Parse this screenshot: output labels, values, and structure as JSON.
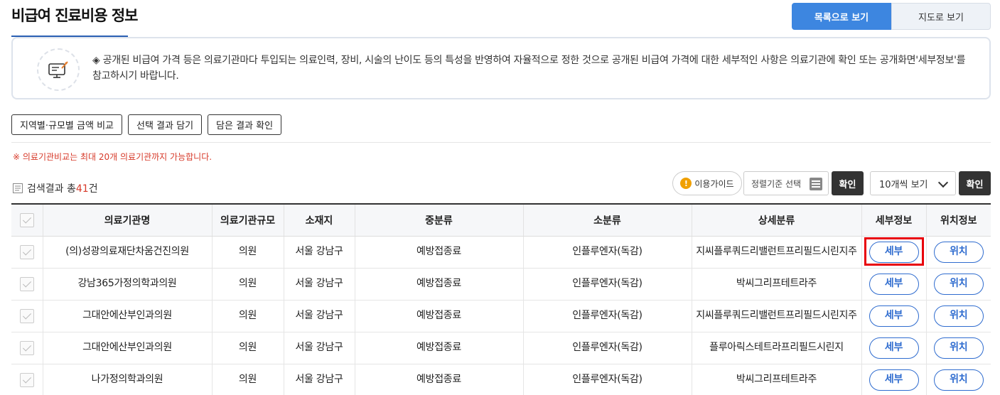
{
  "header": {
    "title": "비급여 진료비용 정보",
    "list_view_label": "목록으로 보기",
    "map_view_label": "지도로 보기"
  },
  "notice": {
    "text": "◈ 공개된 비급여 가격 등은 의료기관마다 투입되는 의료인력, 장비, 시술의 난이도 등의 특성을 반영하여 자율적으로 정한 것으로 공개된 비급여 가격에 대한 세부적인 사항은 의료기관에 확인 또는 공개화면'세부정보'를 참고하시기 바랍니다.",
    "icon": "monitor-icon"
  },
  "actions": {
    "compare_label": "지역별·규모별 금액 비교",
    "select_add_label": "선택 결과 담기",
    "check_saved_label": "담은 결과 확인"
  },
  "compare_note": "※ 의료기관비교는 최대 20개 의료기관까지 가능합니다.",
  "results": {
    "prefix": "검색결과 총",
    "count": "41",
    "suffix": "건"
  },
  "toolbar": {
    "guide_label": "이용가이드",
    "sort_label": "정렬기준 선택",
    "confirm_label": "확인",
    "page_size_label": "10개씩 보기",
    "confirm2_label": "확인"
  },
  "table": {
    "headers": [
      "의료기관명",
      "의료기관규모",
      "소재지",
      "중분류",
      "소분류",
      "상세분류",
      "세부정보",
      "위치정보"
    ],
    "detail_label": "세부",
    "location_label": "위치",
    "rows": [
      {
        "name": "(의)성광의료재단차움건진의원",
        "scale": "의원",
        "location": "서울 강남구",
        "mid": "예방접종료",
        "sub": "인플루엔자(독감)",
        "detail": "지씨플루쿼드리밸런트프리필드시린지주"
      },
      {
        "name": "강남365가정의학과의원",
        "scale": "의원",
        "location": "서울 강남구",
        "mid": "예방접종료",
        "sub": "인플루엔자(독감)",
        "detail": "박씨그리프테트라주"
      },
      {
        "name": "그대안에산부인과의원",
        "scale": "의원",
        "location": "서울 강남구",
        "mid": "예방접종료",
        "sub": "인플루엔자(독감)",
        "detail": "지씨플루쿼드리밸런트프리필드시린지주"
      },
      {
        "name": "그대안에산부인과의원",
        "scale": "의원",
        "location": "서울 강남구",
        "mid": "예방접종료",
        "sub": "인플루엔자(독감)",
        "detail": "플루아릭스테트라프리필드시린지"
      },
      {
        "name": "나가정의학과의원",
        "scale": "의원",
        "location": "서울 강남구",
        "mid": "예방접종료",
        "sub": "인플루엔자(독감)",
        "detail": "박씨그리프테트라주"
      }
    ]
  }
}
